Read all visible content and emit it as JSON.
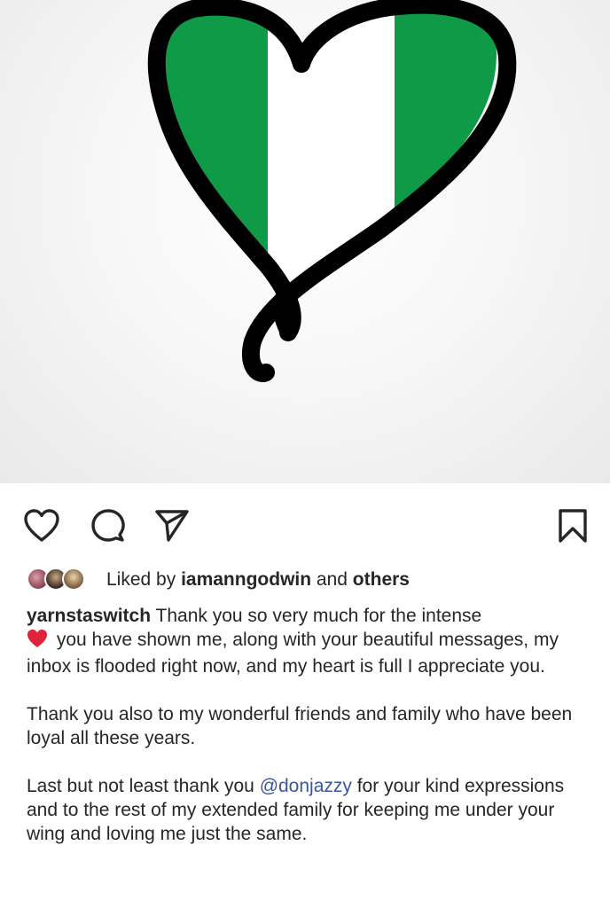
{
  "post": {
    "image": {
      "description_icon": "nigeria-flag-heart",
      "flag_colors": {
        "green": "#0f9a47",
        "white": "#ffffff",
        "outline": "#000000"
      }
    }
  },
  "actions": {
    "like_icon": "heart-outline-icon",
    "comment_icon": "comment-bubble-icon",
    "share_icon": "send-paper-plane-icon",
    "save_icon": "bookmark-icon"
  },
  "likes": {
    "prefix": "Liked by",
    "user": "iamanngodwin",
    "conjunction": "and",
    "others": "others"
  },
  "caption": {
    "username": "yarnstaswitch",
    "para1_before_emoji": " Thank you so very much  for the intense ",
    "emoji": "red-heart",
    "para1_after_emoji": " you have shown me, along with your beautiful messages, my inbox is flooded right now, and my heart is full I appreciate you.",
    "para2": "Thank you also to my wonderful friends and family who have been loyal all these years.",
    "para3_before_mention": "Last but not least thank you ",
    "mention": "@donjazzy",
    "para3_after_mention": " for your kind expressions and to the rest of my extended family for keeping me under your wing and loving me just the same."
  },
  "colors": {
    "text": "#262626",
    "mention": "#385898",
    "heart_emoji": "#e0223a"
  }
}
